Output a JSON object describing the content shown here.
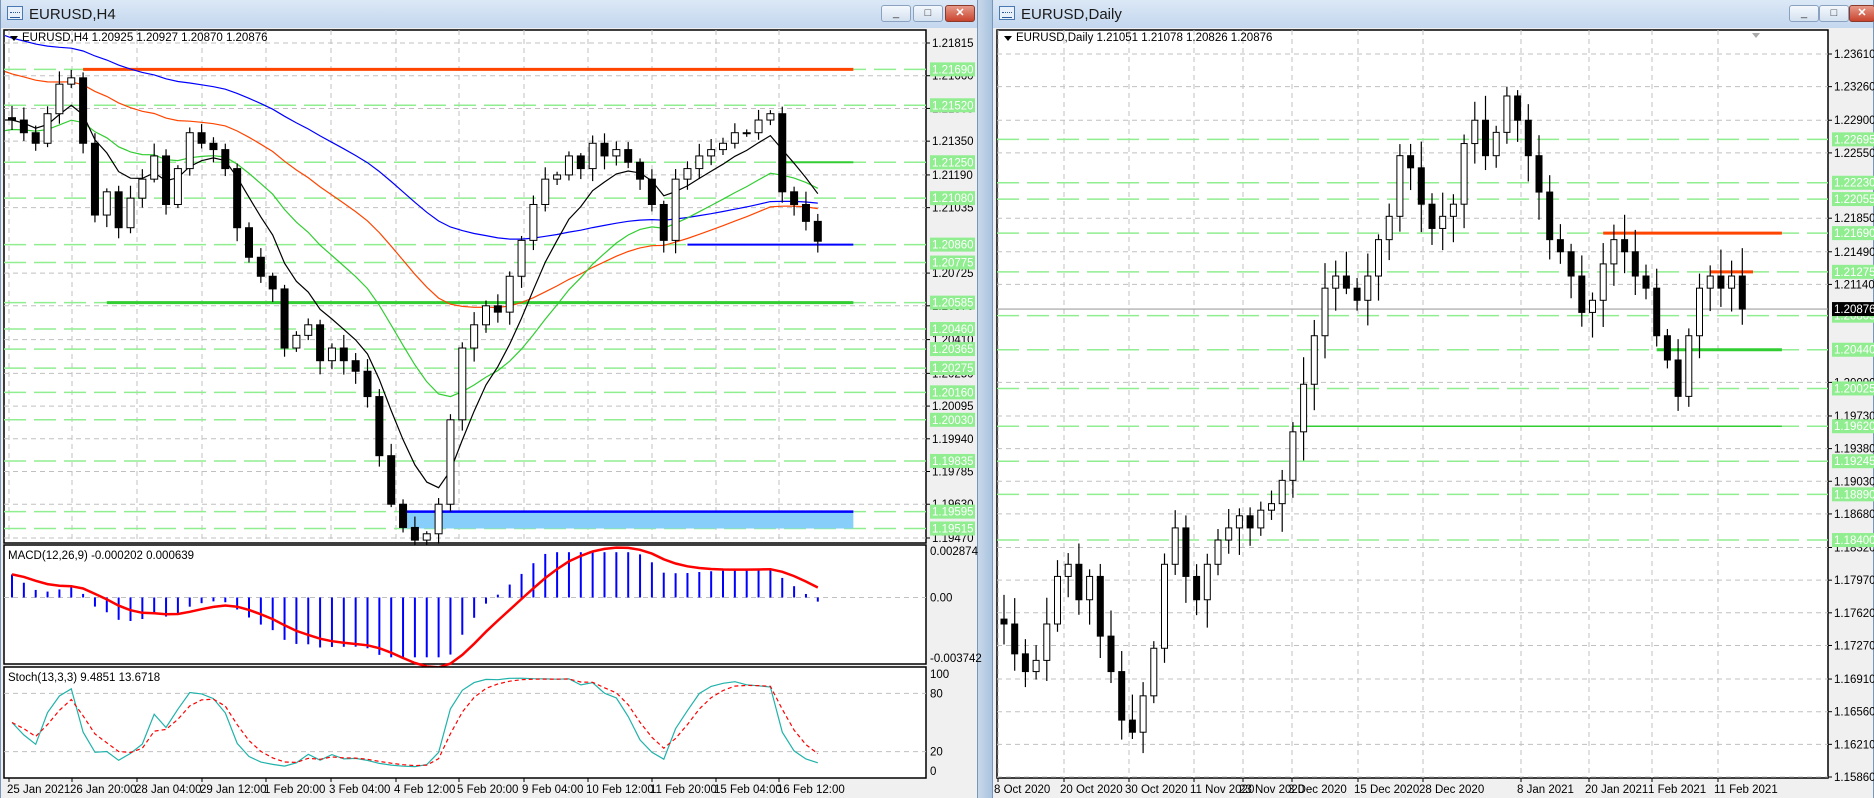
{
  "h4": {
    "window_title": "EURUSD,H4",
    "info": "EURUSD,H4  1.20925 1.20927 1.20870 1.20876",
    "price_labels": [
      "1.21815",
      "1.21660",
      "1.21505",
      "1.21350",
      "1.21190",
      "1.21035",
      "1.20725",
      "1.20570",
      "1.20410",
      "1.20250",
      "1.20095",
      "1.19940",
      "1.19785",
      "1.19630",
      "1.19470"
    ],
    "level_labels": [
      "1.21690",
      "1.21520",
      "1.21250",
      "1.21080",
      "1.20860",
      "1.20775",
      "1.20585",
      "1.20460",
      "1.20365",
      "1.20275",
      "1.20160",
      "1.20030",
      "1.19835",
      "1.19595",
      "1.19515"
    ],
    "time_labels": [
      "25 Jan 2021",
      "26 Jan 20:00",
      "28 Jan 04:00",
      "29 Jan 12:00",
      "1 Feb 20:00",
      "3 Feb 04:00",
      "4 Feb 12:00",
      "5 Feb 20:00",
      "9 Feb 04:00",
      "10 Feb 12:00",
      "11 Feb 20:00",
      "15 Feb 04:00",
      "16 Feb 12:00"
    ],
    "macd": {
      "label": "MACD(12,26,9) -0.000202 0.000639",
      "axis": [
        "0.002874",
        "0.00",
        "-0.003742"
      ]
    },
    "stoch": {
      "label": "Stoch(13,3,3) 9.4851 13.6718",
      "axis": [
        "100",
        "80",
        "20",
        "0"
      ]
    }
  },
  "daily": {
    "window_title": "EURUSD,Daily",
    "info": "EURUSD,Daily  1.21051 1.21078 1.20826 1.20876",
    "price_labels": [
      "1.23610",
      "1.23260",
      "1.22900",
      "1.22550",
      "1.21850",
      "1.21490",
      "1.21140",
      "1.20090",
      "1.19730",
      "1.19380",
      "1.19030",
      "1.18680",
      "1.18320",
      "1.17970",
      "1.17620",
      "1.17270",
      "1.16910",
      "1.16560",
      "1.16210",
      "1.15860"
    ],
    "level_labels": [
      "1.22695",
      "1.22230",
      "1.22055",
      "1.21690",
      "1.21275",
      "1.20805",
      "1.20440",
      "1.20025",
      "1.19620",
      "1.19245",
      "1.18890",
      "1.18400"
    ],
    "current_price": "1.20876",
    "time_labels": [
      "8 Oct 2020",
      "20 Oct 2020",
      "30 Oct 2020",
      "11 Nov 2020",
      "23 Nov 2020",
      "3 Dec 2020",
      "15 Dec 2020",
      "28 Dec 2020",
      "8 Jan 2021",
      "20 Jan 2021",
      "1 Feb 2021",
      "11 Feb 2021"
    ]
  },
  "window_buttons": {
    "minimize": "_",
    "restore": "□",
    "close": "✕"
  },
  "chart_data": [
    {
      "type": "candlestick",
      "title": "EURUSD,H4",
      "ylim": [
        1.1947,
        1.21815
      ],
      "closes": [
        1.2145,
        1.2139,
        1.2134,
        1.2148,
        1.2162,
        1.2165,
        1.2134,
        1.21,
        1.2111,
        1.2094,
        1.2108,
        1.2117,
        1.2128,
        1.2105,
        1.2122,
        1.2139,
        1.2134,
        1.2131,
        1.2122,
        1.2094,
        1.208,
        1.2071,
        1.2065,
        1.2037,
        1.2043,
        1.2048,
        1.2031,
        1.2037,
        1.2031,
        1.2026,
        1.2014,
        1.1986,
        1.1963,
        1.1952,
        1.1946,
        1.1949,
        1.1963,
        1.2003,
        1.2037,
        1.2048,
        1.2057,
        1.2054,
        1.2071,
        1.2088,
        1.2105,
        1.2117,
        1.2119,
        1.2128,
        1.2122,
        1.2134,
        1.2128,
        1.2131,
        1.2125,
        1.2117,
        1.2105,
        1.2088,
        1.2117,
        1.2122,
        1.2128,
        1.2131,
        1.2134,
        1.2139,
        1.2139,
        1.2145,
        1.2148,
        1.2111,
        1.2105,
        1.2097,
        1.20876
      ],
      "moving_averages": [
        {
          "color": "#0000ff",
          "seed": 1.2185,
          "alpha": 0.03
        },
        {
          "color": "#ff4500",
          "seed": 1.2168,
          "alpha": 0.05
        },
        {
          "color": "#32cd32",
          "seed": 1.214,
          "alpha": 0.1
        },
        {
          "color": "#000000",
          "seed": 1.2145,
          "alpha": 0.25
        }
      ],
      "levels": [
        {
          "price": 1.2169,
          "color": "#ff4500",
          "from": 6,
          "to": 71,
          "width": 3
        },
        {
          "price": 1.2125,
          "color": "#32cd32",
          "from": 65,
          "to": 71,
          "width": 2
        },
        {
          "price": 1.2086,
          "color": "#0000ff",
          "from": 57,
          "to": 71,
          "width": 2
        },
        {
          "price": 1.20585,
          "color": "#32cd32",
          "from": 8,
          "to": 71,
          "width": 3
        }
      ],
      "zone": {
        "top": 1.19595,
        "bottom": 1.19515,
        "from": 33,
        "to": 71,
        "fill": "#87cefa",
        "edge": "#0000ff"
      },
      "macd_ylim": [
        -0.003742,
        0.002874
      ],
      "stoch_ylim": [
        0,
        100
      ],
      "stoch_levels": [
        80,
        20
      ]
    },
    {
      "type": "candlestick",
      "title": "EURUSD,Daily",
      "ylim": [
        1.1586,
        1.2361
      ],
      "closes": [
        1.175,
        1.1718,
        1.1699,
        1.1711,
        1.175,
        1.1801,
        1.1814,
        1.1776,
        1.1801,
        1.1737,
        1.1699,
        1.1647,
        1.1634,
        1.1673,
        1.1724,
        1.1814,
        1.1853,
        1.1801,
        1.1776,
        1.1814,
        1.184,
        1.1853,
        1.1866,
        1.1853,
        1.1872,
        1.1879,
        1.1904,
        1.1956,
        1.2007,
        1.2059,
        1.211,
        1.2123,
        1.211,
        1.2097,
        1.2123,
        1.2162,
        1.2187,
        1.2252,
        1.2239,
        1.22,
        1.2174,
        1.2187,
        1.22,
        1.2265,
        1.229,
        1.2252,
        1.2277,
        1.2316,
        1.229,
        1.2252,
        1.2213,
        1.2162,
        1.2149,
        1.2123,
        1.2084,
        1.2097,
        1.2136,
        1.2162,
        1.2149,
        1.2123,
        1.211,
        1.2059,
        1.2033,
        1.1994,
        1.2059,
        1.211,
        1.2123,
        1.211,
        1.2123,
        1.20876
      ],
      "levels": [
        {
          "price": 1.2169,
          "color": "#ff4500",
          "from": 56,
          "to": 72.7,
          "width": 3
        },
        {
          "price": 1.21275,
          "color": "#ff4500",
          "from": 66,
          "to": 70,
          "width": 3
        },
        {
          "price": 1.2044,
          "color": "#32cd32",
          "from": 61,
          "to": 72.7,
          "width": 3
        },
        {
          "price": 1.1962,
          "color": "#32cd32",
          "from": 27,
          "to": 72.7,
          "width": 1.5
        }
      ],
      "current_line": {
        "price": 1.20876,
        "color": "#a0a0a0"
      }
    }
  ]
}
